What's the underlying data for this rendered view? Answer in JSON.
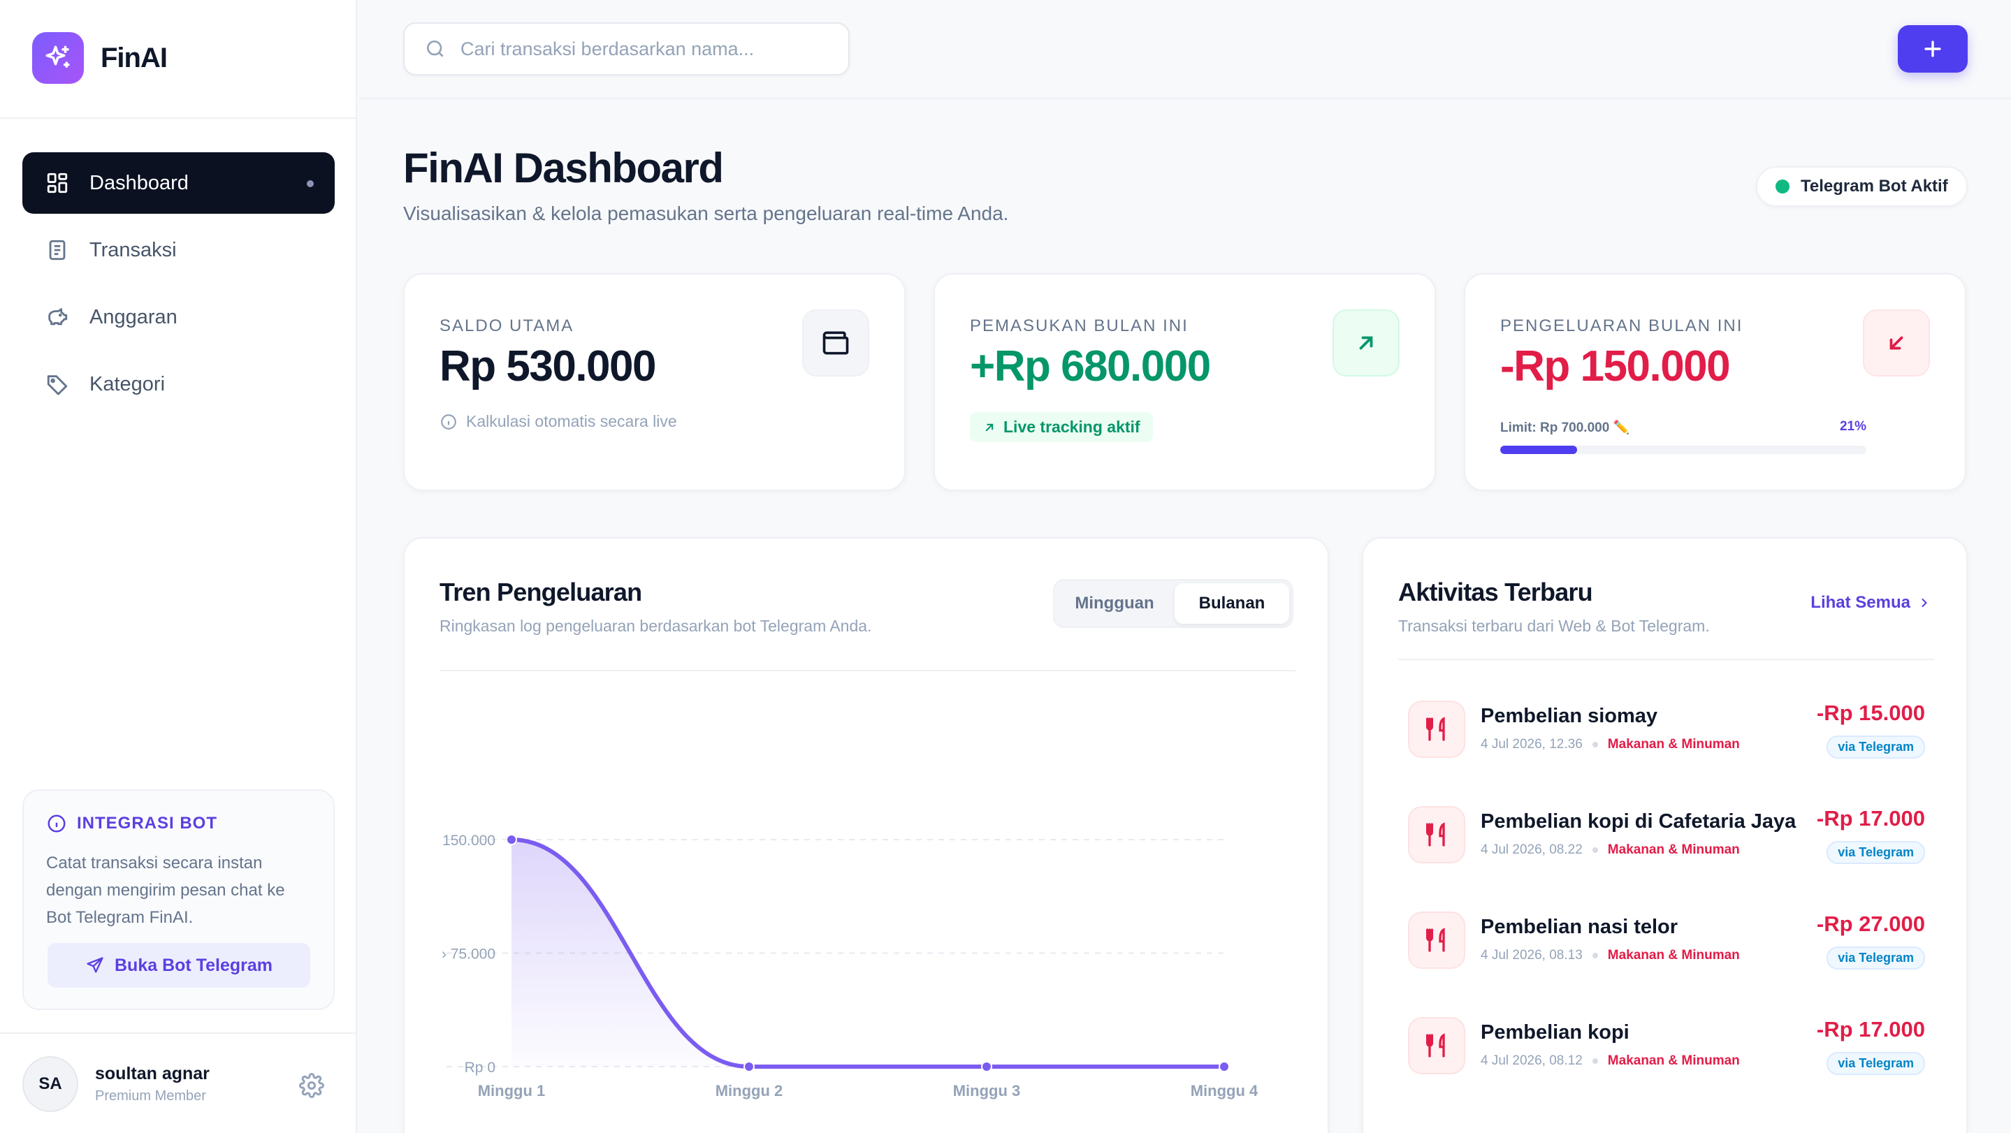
{
  "brand": {
    "name": "FinAI"
  },
  "sidebar": {
    "items": [
      {
        "label": "Dashboard"
      },
      {
        "label": "Transaksi"
      },
      {
        "label": "Anggaran"
      },
      {
        "label": "Kategori"
      }
    ],
    "bot": {
      "title": "INTEGRASI BOT",
      "desc": "Catat transaksi secara instan dengan mengirim pesan chat ke Bot Telegram FinAI.",
      "button": "Buka Bot Telegram"
    },
    "user": {
      "initials": "SA",
      "name": "soultan agnar",
      "role": "Premium Member"
    }
  },
  "search": {
    "placeholder": "Cari transaksi berdasarkan nama..."
  },
  "header": {
    "title": "FinAI Dashboard",
    "subtitle": "Visualisasikan & kelola pemasukan serta pengeluaran real-time Anda.",
    "status": "Telegram Bot Aktif"
  },
  "stats": {
    "saldo": {
      "label": "SALDO UTAMA",
      "value": "Rp 530.000",
      "note": "Kalkulasi otomatis secara live"
    },
    "income": {
      "label": "PEMASUKAN BULAN INI",
      "value": "+Rp 680.000",
      "note": "Live tracking aktif"
    },
    "expense": {
      "label": "PENGELUARAN BULAN INI",
      "value": "-Rp 150.000",
      "limit": "Limit: Rp 700.000 ✏️",
      "pct": "21%",
      "fraction": 0.21
    }
  },
  "chart_section": {
    "title": "Tren Pengeluaran",
    "subtitle": "Ringkasan log pengeluaran berdasarkan bot Telegram Anda.",
    "toggle": [
      "Mingguan",
      "Bulanan"
    ]
  },
  "chart_data": {
    "type": "area",
    "categories": [
      "Minggu 1",
      "Minggu 2",
      "Minggu 3",
      "Minggu 4"
    ],
    "series": [
      {
        "values": [
          150000,
          0,
          0,
          0
        ]
      }
    ],
    "y_ticks": [
      {
        "value": 150000,
        "label": "150.000"
      },
      {
        "value": 75000,
        "label": "› 75.000"
      },
      {
        "value": 0,
        "label": "Rp 0"
      }
    ],
    "ylim": [
      0,
      150000
    ],
    "grid": true,
    "color": "#7b5cf0"
  },
  "activity": {
    "title": "Aktivitas Terbaru",
    "subtitle": "Transaksi terbaru dari Web & Bot Telegram.",
    "see_all": "Lihat Semua",
    "items": [
      {
        "name": "Pembelian siomay",
        "date": "4 Jul 2026, 12.36",
        "category": "Makanan & Minuman",
        "amount": "-Rp 15.000",
        "via": "via Telegram"
      },
      {
        "name": "Pembelian kopi di Cafetaria Jaya",
        "date": "4 Jul 2026, 08.22",
        "category": "Makanan & Minuman",
        "amount": "-Rp 17.000",
        "via": "via Telegram"
      },
      {
        "name": "Pembelian nasi telor",
        "date": "4 Jul 2026, 08.13",
        "category": "Makanan & Minuman",
        "amount": "-Rp 27.000",
        "via": "via Telegram"
      },
      {
        "name": "Pembelian kopi",
        "date": "4 Jul 2026, 08.12",
        "category": "Makanan & Minuman",
        "amount": "-Rp 17.000",
        "via": "via Telegram"
      }
    ]
  },
  "colors": {
    "accent": "#4f3df0",
    "income": "#059669",
    "expense": "#e11d48",
    "dark": "#0b1120"
  }
}
